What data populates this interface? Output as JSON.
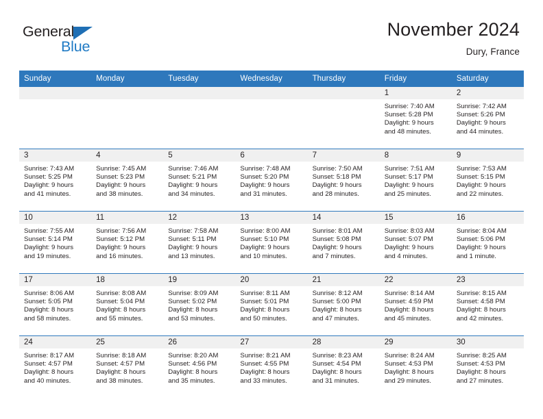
{
  "brand": {
    "word1": "General",
    "word2": "Blue",
    "triangle_color": "#1f6fb5",
    "blue_text_color": "#1f7ac4"
  },
  "header": {
    "title": "November 2024",
    "location": "Dury, France"
  },
  "colors": {
    "header_band": "#2e78bc",
    "daynum_band": "#f0f0f0",
    "text": "#231f20",
    "row_separator": "#2e78bc"
  },
  "calendar": {
    "weekday_headers": [
      "Sunday",
      "Monday",
      "Tuesday",
      "Wednesday",
      "Thursday",
      "Friday",
      "Saturday"
    ],
    "weeks": [
      [
        {
          "day": "",
          "empty": true
        },
        {
          "day": "",
          "empty": true
        },
        {
          "day": "",
          "empty": true
        },
        {
          "day": "",
          "empty": true
        },
        {
          "day": "",
          "empty": true
        },
        {
          "day": "1",
          "sunrise": "Sunrise: 7:40 AM",
          "sunset": "Sunset: 5:28 PM",
          "daylight_line1": "Daylight: 9 hours",
          "daylight_line2": "and 48 minutes."
        },
        {
          "day": "2",
          "sunrise": "Sunrise: 7:42 AM",
          "sunset": "Sunset: 5:26 PM",
          "daylight_line1": "Daylight: 9 hours",
          "daylight_line2": "and 44 minutes."
        }
      ],
      [
        {
          "day": "3",
          "sunrise": "Sunrise: 7:43 AM",
          "sunset": "Sunset: 5:25 PM",
          "daylight_line1": "Daylight: 9 hours",
          "daylight_line2": "and 41 minutes."
        },
        {
          "day": "4",
          "sunrise": "Sunrise: 7:45 AM",
          "sunset": "Sunset: 5:23 PM",
          "daylight_line1": "Daylight: 9 hours",
          "daylight_line2": "and 38 minutes."
        },
        {
          "day": "5",
          "sunrise": "Sunrise: 7:46 AM",
          "sunset": "Sunset: 5:21 PM",
          "daylight_line1": "Daylight: 9 hours",
          "daylight_line2": "and 34 minutes."
        },
        {
          "day": "6",
          "sunrise": "Sunrise: 7:48 AM",
          "sunset": "Sunset: 5:20 PM",
          "daylight_line1": "Daylight: 9 hours",
          "daylight_line2": "and 31 minutes."
        },
        {
          "day": "7",
          "sunrise": "Sunrise: 7:50 AM",
          "sunset": "Sunset: 5:18 PM",
          "daylight_line1": "Daylight: 9 hours",
          "daylight_line2": "and 28 minutes."
        },
        {
          "day": "8",
          "sunrise": "Sunrise: 7:51 AM",
          "sunset": "Sunset: 5:17 PM",
          "daylight_line1": "Daylight: 9 hours",
          "daylight_line2": "and 25 minutes."
        },
        {
          "day": "9",
          "sunrise": "Sunrise: 7:53 AM",
          "sunset": "Sunset: 5:15 PM",
          "daylight_line1": "Daylight: 9 hours",
          "daylight_line2": "and 22 minutes."
        }
      ],
      [
        {
          "day": "10",
          "sunrise": "Sunrise: 7:55 AM",
          "sunset": "Sunset: 5:14 PM",
          "daylight_line1": "Daylight: 9 hours",
          "daylight_line2": "and 19 minutes."
        },
        {
          "day": "11",
          "sunrise": "Sunrise: 7:56 AM",
          "sunset": "Sunset: 5:12 PM",
          "daylight_line1": "Daylight: 9 hours",
          "daylight_line2": "and 16 minutes."
        },
        {
          "day": "12",
          "sunrise": "Sunrise: 7:58 AM",
          "sunset": "Sunset: 5:11 PM",
          "daylight_line1": "Daylight: 9 hours",
          "daylight_line2": "and 13 minutes."
        },
        {
          "day": "13",
          "sunrise": "Sunrise: 8:00 AM",
          "sunset": "Sunset: 5:10 PM",
          "daylight_line1": "Daylight: 9 hours",
          "daylight_line2": "and 10 minutes."
        },
        {
          "day": "14",
          "sunrise": "Sunrise: 8:01 AM",
          "sunset": "Sunset: 5:08 PM",
          "daylight_line1": "Daylight: 9 hours",
          "daylight_line2": "and 7 minutes."
        },
        {
          "day": "15",
          "sunrise": "Sunrise: 8:03 AM",
          "sunset": "Sunset: 5:07 PM",
          "daylight_line1": "Daylight: 9 hours",
          "daylight_line2": "and 4 minutes."
        },
        {
          "day": "16",
          "sunrise": "Sunrise: 8:04 AM",
          "sunset": "Sunset: 5:06 PM",
          "daylight_line1": "Daylight: 9 hours",
          "daylight_line2": "and 1 minute."
        }
      ],
      [
        {
          "day": "17",
          "sunrise": "Sunrise: 8:06 AM",
          "sunset": "Sunset: 5:05 PM",
          "daylight_line1": "Daylight: 8 hours",
          "daylight_line2": "and 58 minutes."
        },
        {
          "day": "18",
          "sunrise": "Sunrise: 8:08 AM",
          "sunset": "Sunset: 5:04 PM",
          "daylight_line1": "Daylight: 8 hours",
          "daylight_line2": "and 55 minutes."
        },
        {
          "day": "19",
          "sunrise": "Sunrise: 8:09 AM",
          "sunset": "Sunset: 5:02 PM",
          "daylight_line1": "Daylight: 8 hours",
          "daylight_line2": "and 53 minutes."
        },
        {
          "day": "20",
          "sunrise": "Sunrise: 8:11 AM",
          "sunset": "Sunset: 5:01 PM",
          "daylight_line1": "Daylight: 8 hours",
          "daylight_line2": "and 50 minutes."
        },
        {
          "day": "21",
          "sunrise": "Sunrise: 8:12 AM",
          "sunset": "Sunset: 5:00 PM",
          "daylight_line1": "Daylight: 8 hours",
          "daylight_line2": "and 47 minutes."
        },
        {
          "day": "22",
          "sunrise": "Sunrise: 8:14 AM",
          "sunset": "Sunset: 4:59 PM",
          "daylight_line1": "Daylight: 8 hours",
          "daylight_line2": "and 45 minutes."
        },
        {
          "day": "23",
          "sunrise": "Sunrise: 8:15 AM",
          "sunset": "Sunset: 4:58 PM",
          "daylight_line1": "Daylight: 8 hours",
          "daylight_line2": "and 42 minutes."
        }
      ],
      [
        {
          "day": "24",
          "sunrise": "Sunrise: 8:17 AM",
          "sunset": "Sunset: 4:57 PM",
          "daylight_line1": "Daylight: 8 hours",
          "daylight_line2": "and 40 minutes."
        },
        {
          "day": "25",
          "sunrise": "Sunrise: 8:18 AM",
          "sunset": "Sunset: 4:57 PM",
          "daylight_line1": "Daylight: 8 hours",
          "daylight_line2": "and 38 minutes."
        },
        {
          "day": "26",
          "sunrise": "Sunrise: 8:20 AM",
          "sunset": "Sunset: 4:56 PM",
          "daylight_line1": "Daylight: 8 hours",
          "daylight_line2": "and 35 minutes."
        },
        {
          "day": "27",
          "sunrise": "Sunrise: 8:21 AM",
          "sunset": "Sunset: 4:55 PM",
          "daylight_line1": "Daylight: 8 hours",
          "daylight_line2": "and 33 minutes."
        },
        {
          "day": "28",
          "sunrise": "Sunrise: 8:23 AM",
          "sunset": "Sunset: 4:54 PM",
          "daylight_line1": "Daylight: 8 hours",
          "daylight_line2": "and 31 minutes."
        },
        {
          "day": "29",
          "sunrise": "Sunrise: 8:24 AM",
          "sunset": "Sunset: 4:53 PM",
          "daylight_line1": "Daylight: 8 hours",
          "daylight_line2": "and 29 minutes."
        },
        {
          "day": "30",
          "sunrise": "Sunrise: 8:25 AM",
          "sunset": "Sunset: 4:53 PM",
          "daylight_line1": "Daylight: 8 hours",
          "daylight_line2": "and 27 minutes."
        }
      ]
    ]
  }
}
